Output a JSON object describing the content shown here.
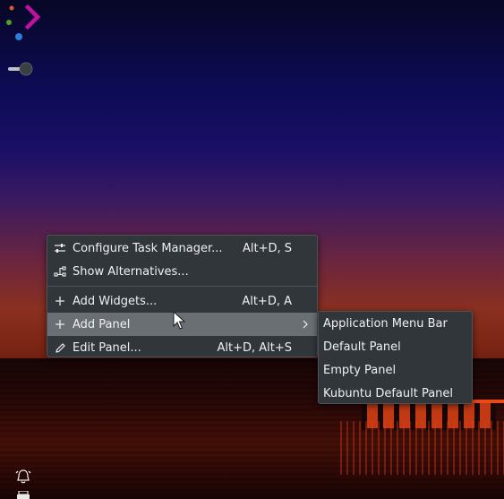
{
  "desktop": {
    "logo_icon": "kubuntu-logo-icon",
    "toggle_icon": "toggle-switch-icon",
    "tray_icons": [
      "notification-bell-icon",
      "printer-icon"
    ]
  },
  "menu": {
    "items": [
      {
        "icon": "configure-sliders-icon",
        "label": "Configure Task Manager...",
        "shortcut": "Alt+D, S"
      },
      {
        "icon": "alternatives-icon",
        "label": "Show Alternatives...",
        "shortcut": ""
      },
      {
        "icon": "plus-icon",
        "label": "Add Widgets...",
        "shortcut": "Alt+D, A"
      },
      {
        "icon": "plus-icon",
        "label": "Add Panel",
        "shortcut": "",
        "submenu": true
      },
      {
        "icon": "pencil-icon",
        "label": "Edit Panel...",
        "shortcut": "Alt+D, Alt+S"
      }
    ]
  },
  "submenu": {
    "items": [
      {
        "label": "Application Menu Bar"
      },
      {
        "label": "Default Panel"
      },
      {
        "label": "Empty Panel"
      },
      {
        "label": "Kubuntu Default Panel"
      }
    ]
  },
  "colors": {
    "menu_bg": "#31363b",
    "menu_text": "#eff0f1",
    "highlight": "#6a6f74",
    "accent_magenta": "#c211a1"
  }
}
